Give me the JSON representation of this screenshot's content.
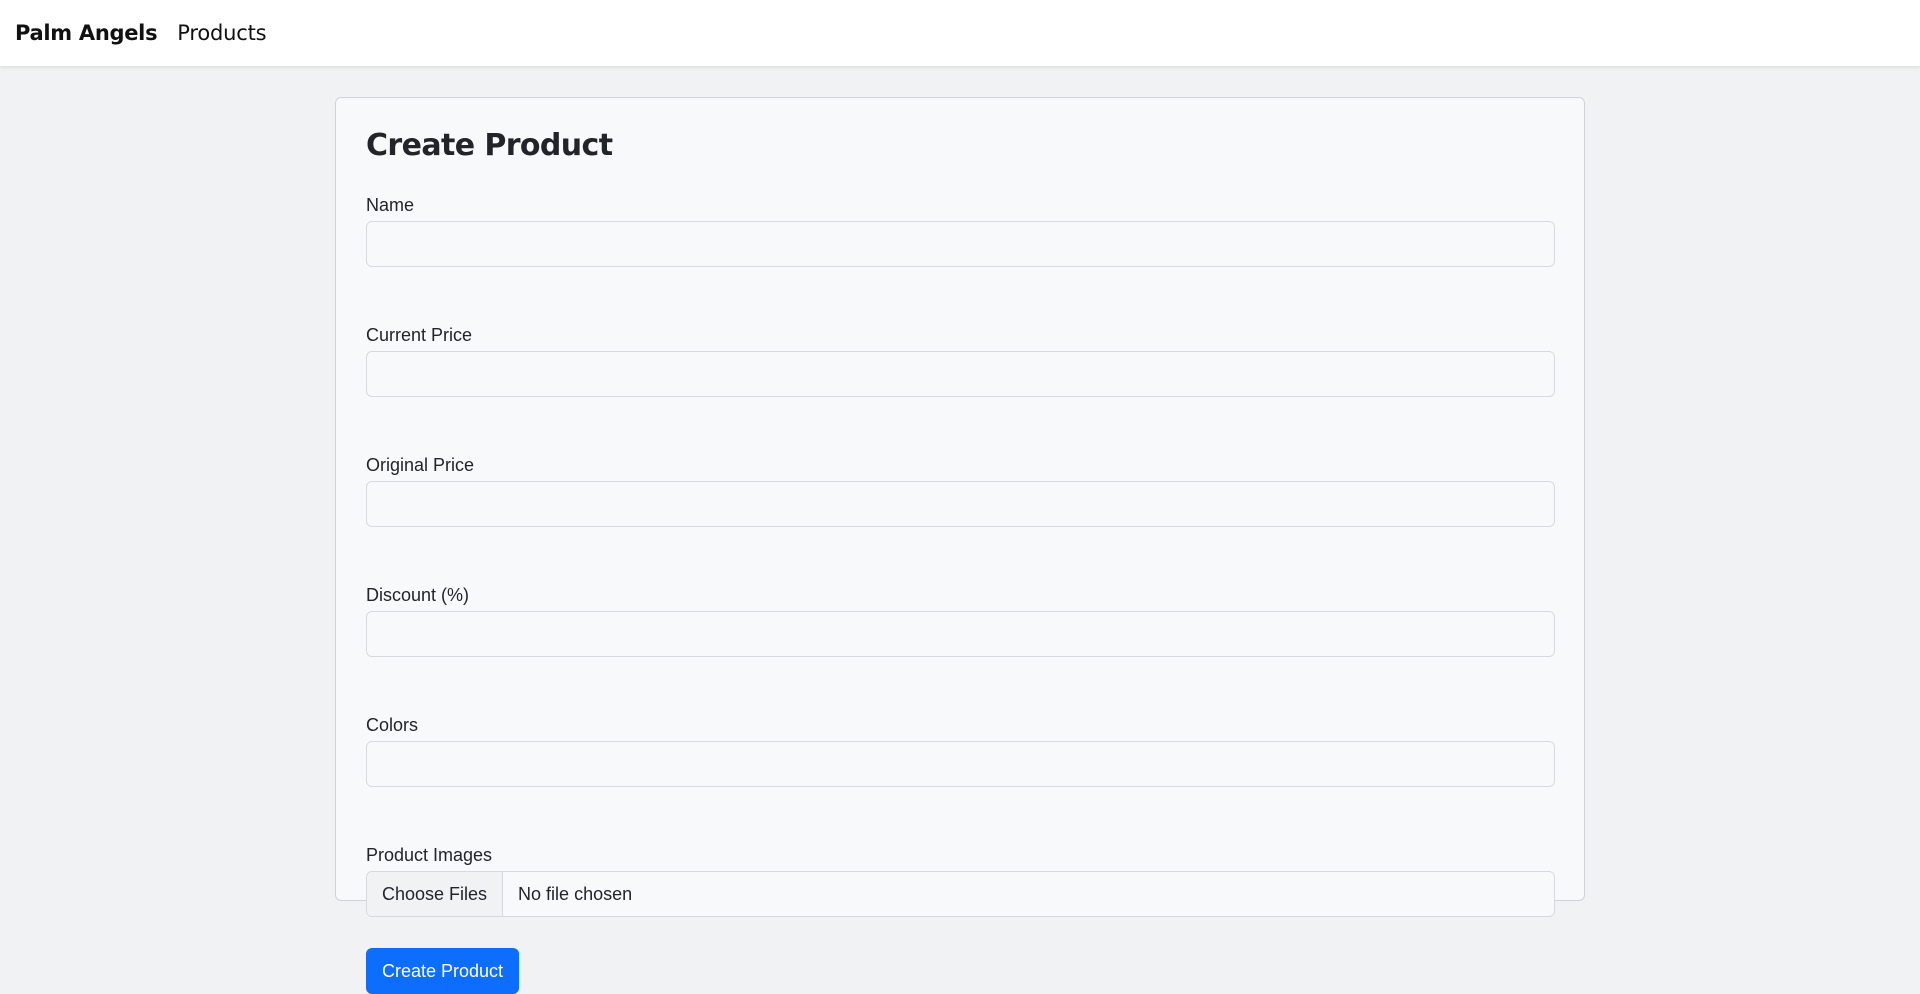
{
  "navbar": {
    "brand": "Palm Angels",
    "links": [
      {
        "label": "Products"
      }
    ]
  },
  "form": {
    "title": "Create Product",
    "fields": [
      {
        "label": "Name",
        "value": ""
      },
      {
        "label": "Current Price",
        "value": ""
      },
      {
        "label": "Original Price",
        "value": ""
      },
      {
        "label": "Discount (%)",
        "value": ""
      },
      {
        "label": "Colors",
        "value": ""
      }
    ],
    "images": {
      "label": "Product Images",
      "button_label": "Choose Files",
      "status": "No file chosen"
    },
    "submit_label": "Create Product"
  },
  "colors": {
    "primary": "#0d6efd",
    "page_background": "#f1f2f4",
    "card_background": "#f8f9fa"
  }
}
